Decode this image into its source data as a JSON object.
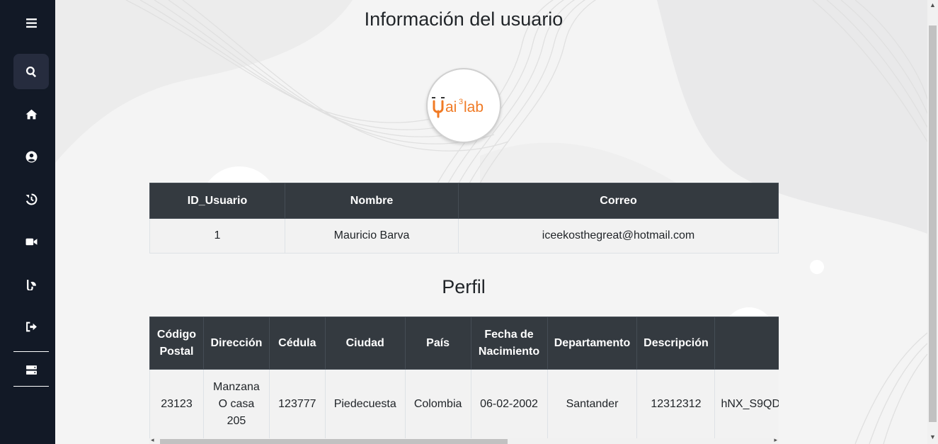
{
  "sidebar": {
    "items": [
      {
        "name": "menu",
        "icon": "hamburger-menu-icon"
      },
      {
        "name": "search",
        "icon": "search-icon"
      },
      {
        "name": "home",
        "icon": "home-icon"
      },
      {
        "name": "profile",
        "icon": "user-circle-icon"
      },
      {
        "name": "history",
        "icon": "history-icon"
      },
      {
        "name": "video",
        "icon": "video-camera-icon"
      },
      {
        "name": "analytics",
        "icon": "chart-icon"
      },
      {
        "name": "logout",
        "icon": "sign-out-icon"
      },
      {
        "name": "server",
        "icon": "server-icon"
      }
    ]
  },
  "header": {
    "title": "Información del usuario"
  },
  "logo": {
    "prefix": "ai",
    "sup": "3",
    "suffix": "lab"
  },
  "user_table": {
    "columns": [
      "ID_Usuario",
      "Nombre",
      "Correo"
    ],
    "rows": [
      [
        "1",
        "Mauricio Barva",
        "iceekosthegreat@hotmail.com"
      ]
    ]
  },
  "profile": {
    "title": "Perfil",
    "columns": [
      "Código Postal",
      "Dirección",
      "Cédula",
      "Ciudad",
      "País",
      "Fecha de Nacimiento",
      "Departamento",
      "Descripción",
      ""
    ],
    "rows": [
      [
        "23123",
        "Manzana O casa 205",
        "123777",
        "Piedecuesta",
        "Colombia",
        "06-02-2002",
        "Santander",
        "12312312",
        "hNX_S9QD"
      ]
    ]
  },
  "colors": {
    "sidebar_bg": "#121926",
    "table_header_bg": "#343a40",
    "logo_orange": "#f07a24"
  }
}
